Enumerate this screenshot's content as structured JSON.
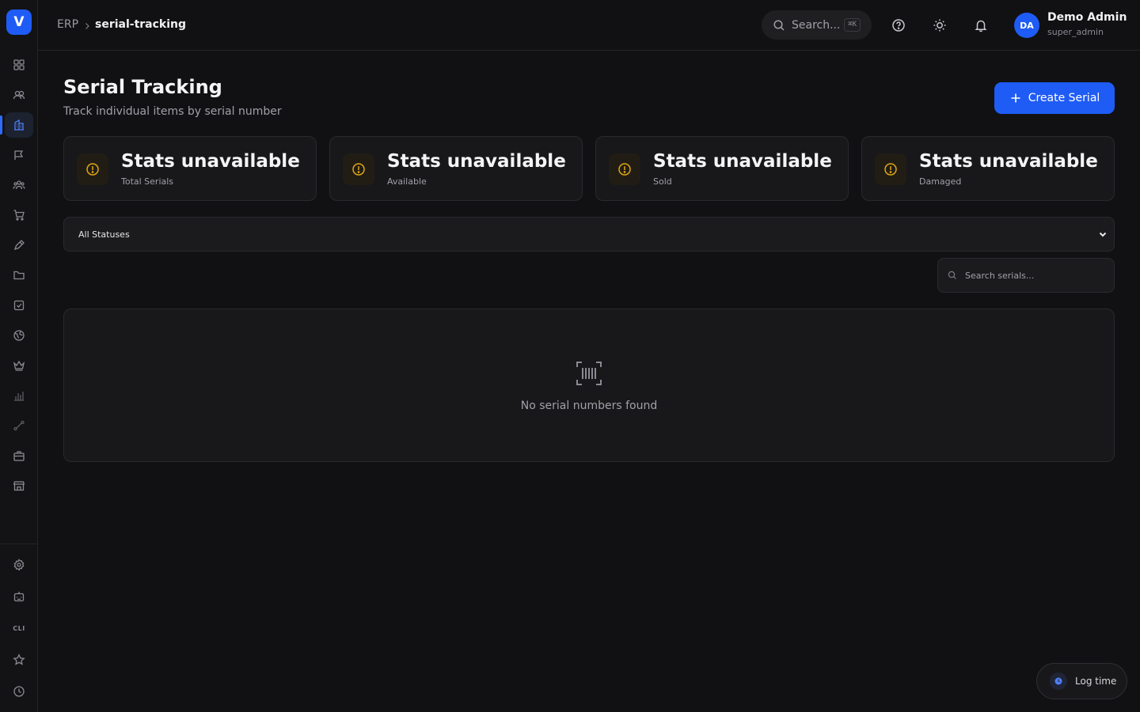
{
  "app": {
    "logo_letter": "V"
  },
  "breadcrumb": {
    "root": "ERP",
    "current": "serial-tracking"
  },
  "topbar": {
    "search_label": "Search...",
    "search_shortcut": "⌘K",
    "user": {
      "initials": "DA",
      "name": "Demo Admin",
      "role": "super_admin"
    }
  },
  "sidebar": {
    "items": [
      {
        "icon": "dashboard-icon"
      },
      {
        "icon": "users-icon"
      },
      {
        "icon": "buildings-icon",
        "active": true
      },
      {
        "icon": "flag-icon"
      },
      {
        "icon": "team-icon"
      },
      {
        "icon": "cart-icon"
      },
      {
        "icon": "pen-icon"
      },
      {
        "icon": "folder-icon"
      },
      {
        "icon": "checkbox-icon"
      },
      {
        "icon": "globe-icon"
      },
      {
        "icon": "crown-icon"
      },
      {
        "icon": "bar-chart-icon"
      },
      {
        "icon": "route-icon"
      },
      {
        "icon": "briefcase-icon"
      },
      {
        "icon": "store-icon"
      }
    ],
    "bottom_items": [
      {
        "icon": "settings-icon"
      },
      {
        "icon": "robot-icon"
      },
      {
        "label": "CLI"
      },
      {
        "icon": "star-icon"
      },
      {
        "icon": "clock-icon"
      }
    ]
  },
  "page": {
    "title": "Serial Tracking",
    "subtitle": "Track individual items by serial number",
    "create_button": "Create Serial"
  },
  "stats": [
    {
      "value": "Stats unavailable",
      "label": "Total Serials",
      "icon": "alert-circle-icon",
      "accent": "#e0a515"
    },
    {
      "value": "Stats unavailable",
      "label": "Available",
      "icon": "alert-circle-icon",
      "accent": "#e0a515"
    },
    {
      "value": "Stats unavailable",
      "label": "Sold",
      "icon": "alert-circle-icon",
      "accent": "#e0a515"
    },
    {
      "value": "Stats unavailable",
      "label": "Damaged",
      "icon": "alert-circle-icon",
      "accent": "#e0a515"
    }
  ],
  "filters": {
    "status_selected": "All Statuses",
    "search_placeholder": "Search serials..."
  },
  "empty_state": {
    "icon": "barcode-icon",
    "message": "No serial numbers found"
  },
  "log_time": {
    "label": "Log time"
  },
  "colors": {
    "accent": "#1f5cf5",
    "background": "#111113",
    "warning": "#e0a515"
  }
}
